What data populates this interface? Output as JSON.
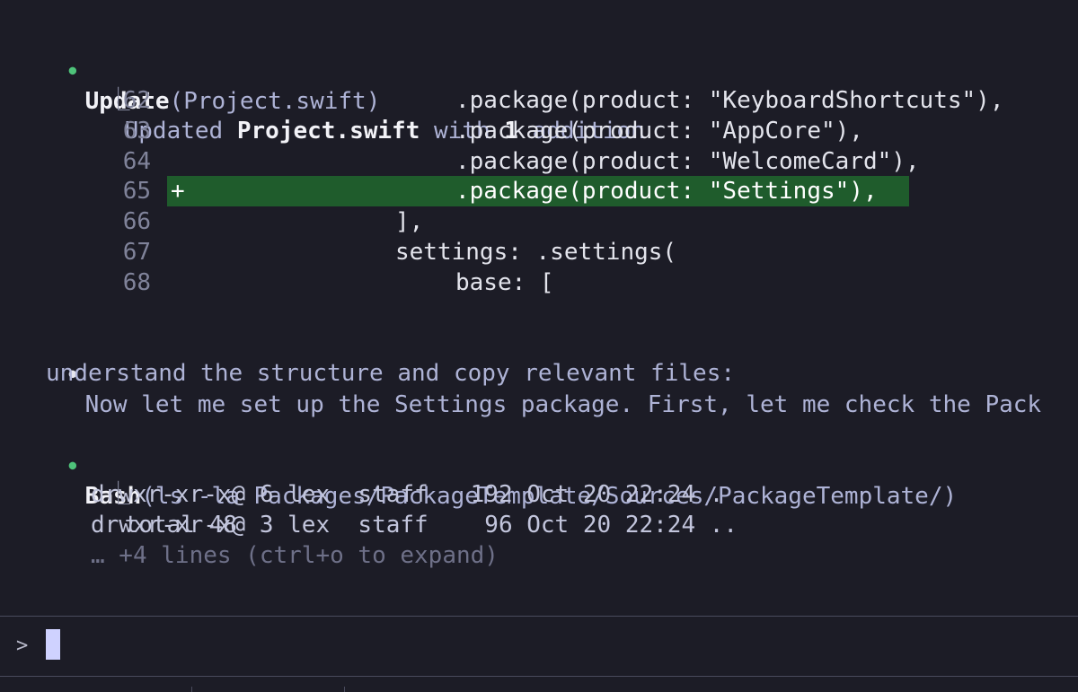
{
  "update_block": {
    "tool_name": "Update",
    "tool_arg": "(Project.swift)",
    "summary_prefix": "Updated ",
    "summary_file": "Project.swift",
    "summary_mid": " with ",
    "summary_count": "1",
    "summary_suffix": " addition",
    "diff_lines": [
      {
        "num": "62",
        "marker": "",
        "code": ".package(product: \"KeyboardShortcuts\"),"
      },
      {
        "num": "63",
        "marker": "",
        "code": ".package(product: \"AppCore\"),"
      },
      {
        "num": "64",
        "marker": "",
        "code": ".package(product: \"WelcomeCard\"),"
      },
      {
        "num": "65",
        "marker": "+",
        "code": ".package(product: \"Settings\"),"
      },
      {
        "num": "66",
        "marker": "",
        "code": "],"
      },
      {
        "num": "67",
        "marker": "",
        "code": "settings: .settings("
      },
      {
        "num": "68",
        "marker": "",
        "code": "base: ["
      }
    ]
  },
  "message_block": {
    "line1": "Now let me set up the Settings package. First, let me check the Pack",
    "line2": "understand the structure and copy relevant files:"
  },
  "bash_block": {
    "tool_name": "Bash",
    "tool_arg": "(ls -la Packages/PackageTemplate/Sources/PackageTemplate/)",
    "output": [
      "total 48",
      "drwxr-xr-x@ 6 lex  staff   192 Oct 20 22:24 .",
      "drwxr-xr-x@ 3 lex  staff    96 Oct 20 22:24 .."
    ],
    "collapsed_hint": "… +4 lines (ctrl+o to expand)"
  },
  "input": {
    "prompt_symbol": ">",
    "value": ""
  },
  "symbols": {
    "bullet": "●",
    "tree": "⎿"
  },
  "colors": {
    "background": "#1c1c26",
    "tool_bullet": "#4ec37a",
    "added_line_bg": "#1f5c2c",
    "cursor": "#cfd2ff"
  }
}
